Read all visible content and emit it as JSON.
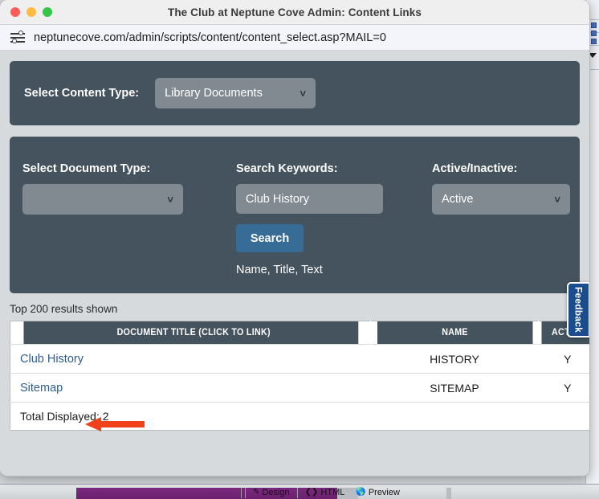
{
  "window": {
    "title": "The Club at Neptune Cove Admin: Content Links",
    "traffic_lights": [
      "close",
      "minimize",
      "zoom"
    ],
    "url": "neptunecove.com/admin/scripts/content/content_select.asp?MAIL=0",
    "url_icon": "page-settings-sliders-icon"
  },
  "content_type_panel": {
    "label": "Select Content Type:",
    "select_value": "Library Documents",
    "caret_icon": "chevron-down-icon"
  },
  "search_panel": {
    "document_type": {
      "label": "Select Document Type:",
      "select_value": "",
      "caret_icon": "chevron-down-icon"
    },
    "keywords": {
      "label": "Search Keywords:",
      "value": "Club History",
      "placeholder": ""
    },
    "active_inactive": {
      "label": "Active/Inactive:",
      "select_value": "Active",
      "caret_icon": "chevron-down-icon"
    },
    "search_button": "Search",
    "hint": "Name, Title, Text"
  },
  "results": {
    "note": "Top 200 results shown",
    "columns": [
      "DOCUMENT TITLE (CLICK TO LINK)",
      "NAME",
      "ACTIVE"
    ],
    "rows": [
      {
        "title": "Club History",
        "name": "HISTORY",
        "active": "Y"
      },
      {
        "title": "Sitemap",
        "name": "SITEMAP",
        "active": "Y"
      }
    ],
    "total": "Total Displayed: 2"
  },
  "feedback_tab": {
    "label": "Feedback"
  },
  "annotation": {
    "arrow_color": "#f0411c",
    "arrow_direction": "left",
    "points_at": "Club History"
  },
  "background_app": {
    "tabs": [
      {
        "label": "Design",
        "icon": "pencil-icon"
      },
      {
        "label": "HTML",
        "icon": "code-brackets-icon"
      },
      {
        "label": "Preview",
        "icon": "globe-icon"
      }
    ]
  },
  "colors": {
    "panel_dark": "#44535d",
    "select_gray": "#808a90",
    "button_blue": "#366c96",
    "link_blue": "#2b5d92",
    "page_bg": "#d6dadd",
    "feedback_blue": "#1b4d8e"
  }
}
